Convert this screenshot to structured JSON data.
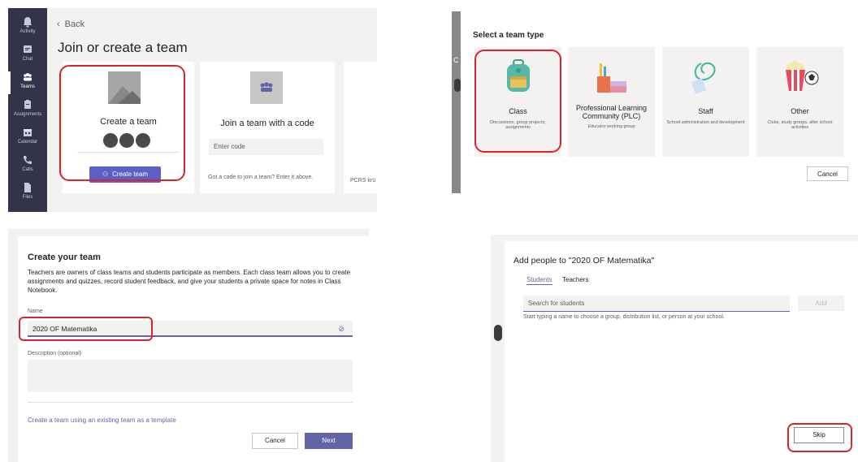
{
  "panel1": {
    "rail": [
      {
        "label": "Activity",
        "icon": "bell-icon"
      },
      {
        "label": "Chat",
        "icon": "chat-icon"
      },
      {
        "label": "Teams",
        "icon": "teams-icon"
      },
      {
        "label": "Assignments",
        "icon": "assignments-icon"
      },
      {
        "label": "Calendar",
        "icon": "calendar-icon"
      },
      {
        "label": "Calls",
        "icon": "phone-icon"
      },
      {
        "label": "Files",
        "icon": "files-icon"
      }
    ],
    "back_label": "Back",
    "title": "Join or create a team",
    "create_card": {
      "title": "Create a team",
      "button": "Create team"
    },
    "join_card": {
      "title": "Join a team with a code",
      "placeholder": "Enter code",
      "hint": "Got a code to join a team? Enter it above."
    },
    "third_card_text": "PCRS krü"
  },
  "panel2": {
    "title": "Select a team type",
    "types": [
      {
        "title": "Class",
        "desc": "Discussions, group projects, assignments"
      },
      {
        "title": "Professional Learning Community (PLC)",
        "desc": "Educator working group"
      },
      {
        "title": "Staff",
        "desc": "School administration and development"
      },
      {
        "title": "Other",
        "desc": "Clubs, study groups, after school activities"
      }
    ],
    "cancel": "Cancel",
    "side_letter": "C"
  },
  "panel3": {
    "title": "Create your team",
    "description": "Teachers are owners of class teams and students participate as members. Each class team allows you to create assignments and quizzes, record student feedback, and give your students a private space for notes in Class Notebook.",
    "name_label": "Name",
    "name_value": "2020 OF Matematika",
    "desc_label": "Description (optional)",
    "template_link": "Create a team using an existing team as a template",
    "cancel": "Cancel",
    "next": "Next"
  },
  "panel4": {
    "title": "Add people to \"2020 OF Matematika\"",
    "tabs": [
      "Students",
      "Teachers"
    ],
    "search_placeholder": "Search for students",
    "add": "Add",
    "hint": "Start typing a name to choose a group, distribution list, or person at your school.",
    "skip": "Skip"
  },
  "colors": {
    "accent": "#6264a7",
    "highlight": "#d9262c",
    "rail": "#33344a"
  }
}
